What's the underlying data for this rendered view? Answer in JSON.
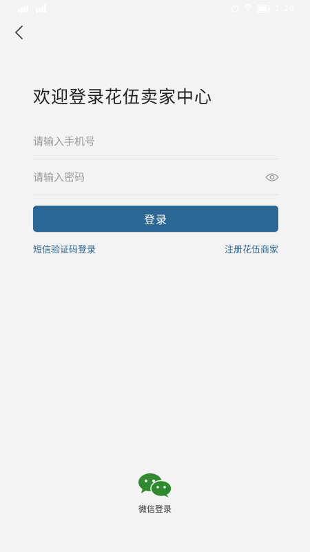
{
  "status_bar": {
    "time": "1:20",
    "carrier_left": "4G",
    "carrier_right": "4G"
  },
  "login": {
    "title": "欢迎登录花伍卖家中心",
    "phone_placeholder": "请输入手机号",
    "password_placeholder": "请输入密码",
    "login_button": "登录",
    "sms_login_link": "短信验证码登录",
    "register_link": "注册花伍商家",
    "wechat_label": "微信登录"
  },
  "colors": {
    "background": "#f3f3f3",
    "accent": "#2b6795",
    "wechat_green": "#2f8a2e"
  },
  "icons": {
    "back": "chevron-left-icon",
    "eye": "eye-icon",
    "wechat": "wechat-icon"
  }
}
